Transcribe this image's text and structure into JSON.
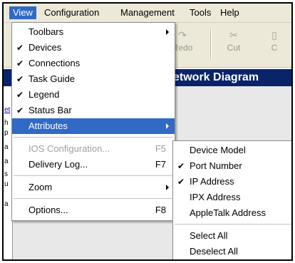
{
  "menubar": {
    "items": [
      "View",
      "Configuration",
      "Management",
      "Tools",
      "Help"
    ]
  },
  "toolbar": {
    "redo_label": "Redo",
    "cut_label": "Cut",
    "cut_partial": "C"
  },
  "diagram": {
    "title": "etwork Diagram"
  },
  "left_strip": {
    "letters": [
      "et",
      "h",
      "p",
      "a",
      "a",
      "s",
      "u",
      "a"
    ]
  },
  "view_menu": {
    "items": [
      {
        "label": "Toolbars",
        "checked": false,
        "submenu": true
      },
      {
        "label": "Devices",
        "checked": true
      },
      {
        "label": "Connections",
        "checked": true
      },
      {
        "label": "Task Guide",
        "checked": true
      },
      {
        "label": "Legend",
        "checked": true
      },
      {
        "label": "Status Bar",
        "checked": true
      },
      {
        "label": "Attributes",
        "checked": false,
        "submenu": true,
        "highlighted": true
      },
      {
        "label": "IOS Configuration...",
        "shortcut": "F5",
        "disabled": true
      },
      {
        "label": "Delivery Log...",
        "shortcut": "F7"
      },
      {
        "label": "Zoom",
        "submenu": true
      },
      {
        "label": "Options...",
        "shortcut": "F8"
      }
    ]
  },
  "attributes_menu": {
    "items": [
      {
        "label": "Device Model",
        "checked": false
      },
      {
        "label": "Port Number",
        "checked": true
      },
      {
        "label": "IP Address",
        "checked": true
      },
      {
        "label": "IPX Address",
        "checked": false
      },
      {
        "label": "AppleTalk Address",
        "checked": false
      },
      {
        "label": "Select All",
        "checked": false
      },
      {
        "label": "Deselect All",
        "checked": false
      }
    ]
  },
  "icons": {
    "check": "✔"
  },
  "colors": {
    "highlight": "#316ac5",
    "menubar": "#ece9d8",
    "title_bar": "#0a246a"
  }
}
